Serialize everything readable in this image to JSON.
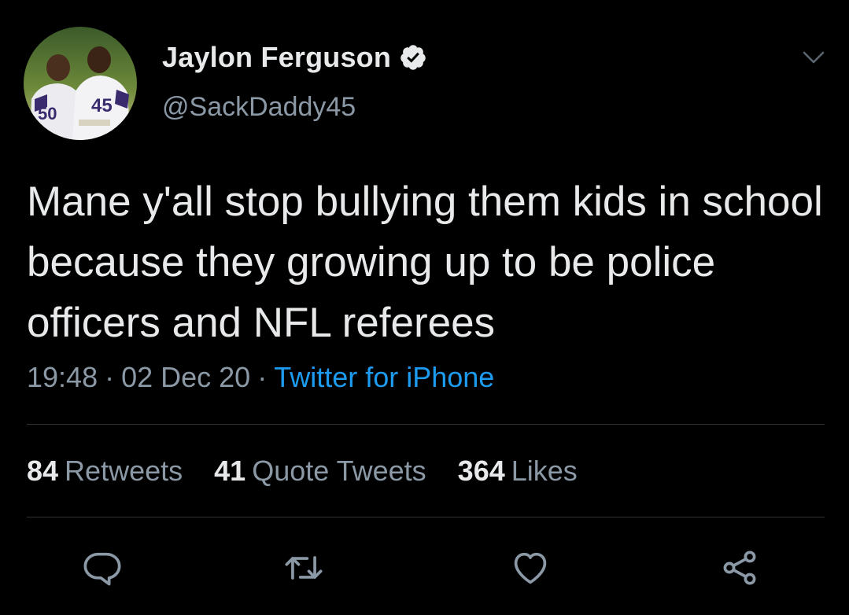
{
  "author": {
    "display_name": "Jaylon Ferguson",
    "handle": "@SackDaddy45",
    "verified": true,
    "avatar_jersey_numbers": [
      "50",
      "45"
    ]
  },
  "tweet": {
    "text": "Mane y'all stop bullying them kids in school because they growing up to be police officers and NFL referees",
    "time": "19:48",
    "date": "02 Dec 20",
    "separator": "·",
    "source": "Twitter for iPhone"
  },
  "stats": {
    "retweets": {
      "count": "84",
      "label": "Retweets"
    },
    "quote_tweets": {
      "count": "41",
      "label": "Quote Tweets"
    },
    "likes": {
      "count": "364",
      "label": "Likes"
    }
  },
  "actions": [
    {
      "name": "reply",
      "icon": "reply-icon"
    },
    {
      "name": "retweet",
      "icon": "retweet-icon"
    },
    {
      "name": "like",
      "icon": "heart-icon"
    },
    {
      "name": "share",
      "icon": "share-icon"
    }
  ],
  "colors": {
    "background": "#000000",
    "primary_text": "#e7e9ea",
    "secondary_text": "#8b98a5",
    "accent": "#1d9bf0",
    "divider": "#2f3336"
  }
}
